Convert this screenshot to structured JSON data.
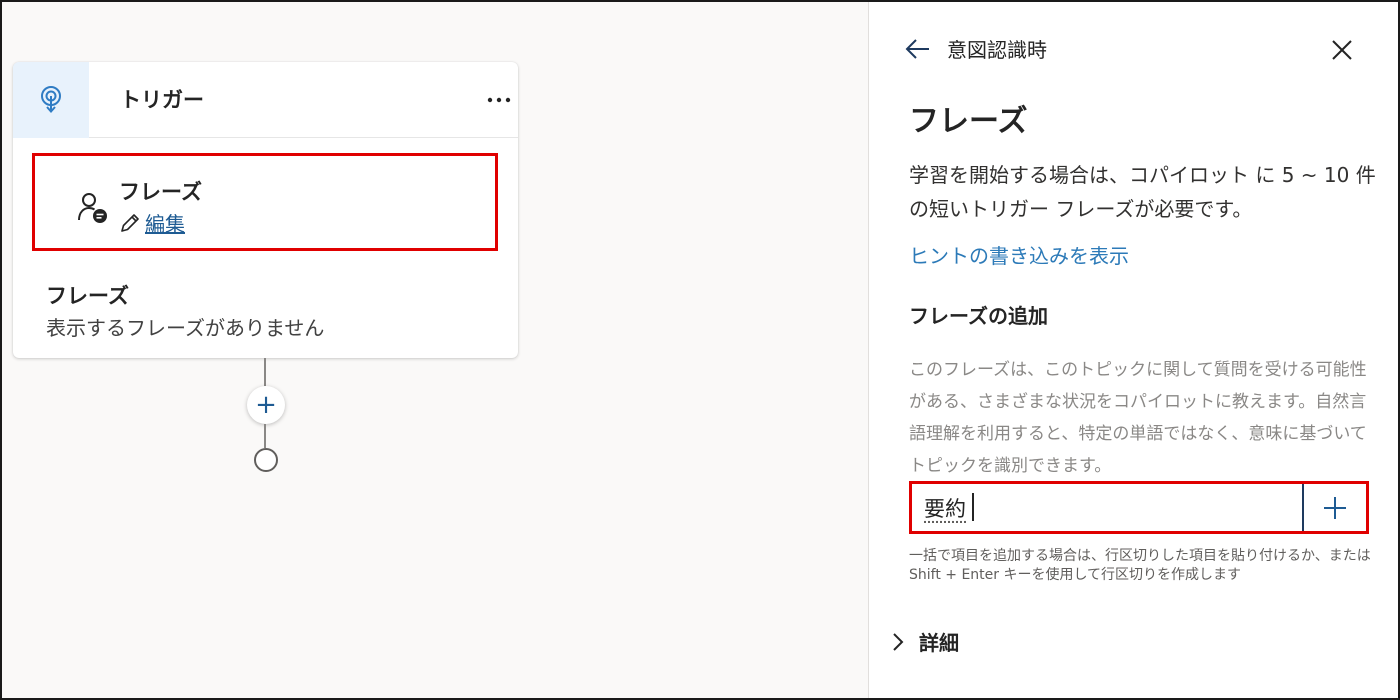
{
  "canvas": {
    "trigger_node": {
      "title": "トリガー",
      "more_label": "···",
      "phrases_entry": {
        "title": "フレーズ",
        "edit_label": "編集"
      },
      "phrases_section": {
        "title": "フレーズ",
        "empty_text": "表示するフレーズがありません"
      }
    },
    "add_node_label": "+"
  },
  "panel": {
    "breadcrumb": "意図認識時",
    "title": "フレーズ",
    "description": "学習を開始する場合は、コパイロット に 5 ~ 10 件の短いトリガー フレーズが必要です。",
    "hint_link": "ヒントの書き込みを表示",
    "add_section": {
      "title": "フレーズの追加",
      "description": "このフレーズは、このトピックに関して質問を受ける可能性がある、さまざまな状況をコパイロットに教えます。自然言語理解を利用すると、特定の単語ではなく、意味に基づいてトピックを識別できます。",
      "input_value": "要約",
      "helper_text": "一括で項目を追加する場合は、行区切りした項目を貼り付けるか、または Shift + Enter キーを使用して行区切りを作成します"
    },
    "details_label": "詳細"
  },
  "colors": {
    "accent": "#1e5b93",
    "link": "#2c7ab8",
    "highlight": "#e00000",
    "icon_bg": "#e8f2fc"
  },
  "icons": [
    "trigger-icon",
    "more-icon",
    "person-chat-icon",
    "pencil-icon",
    "plus-icon",
    "back-arrow-icon",
    "close-icon",
    "chevron-right-icon"
  ]
}
